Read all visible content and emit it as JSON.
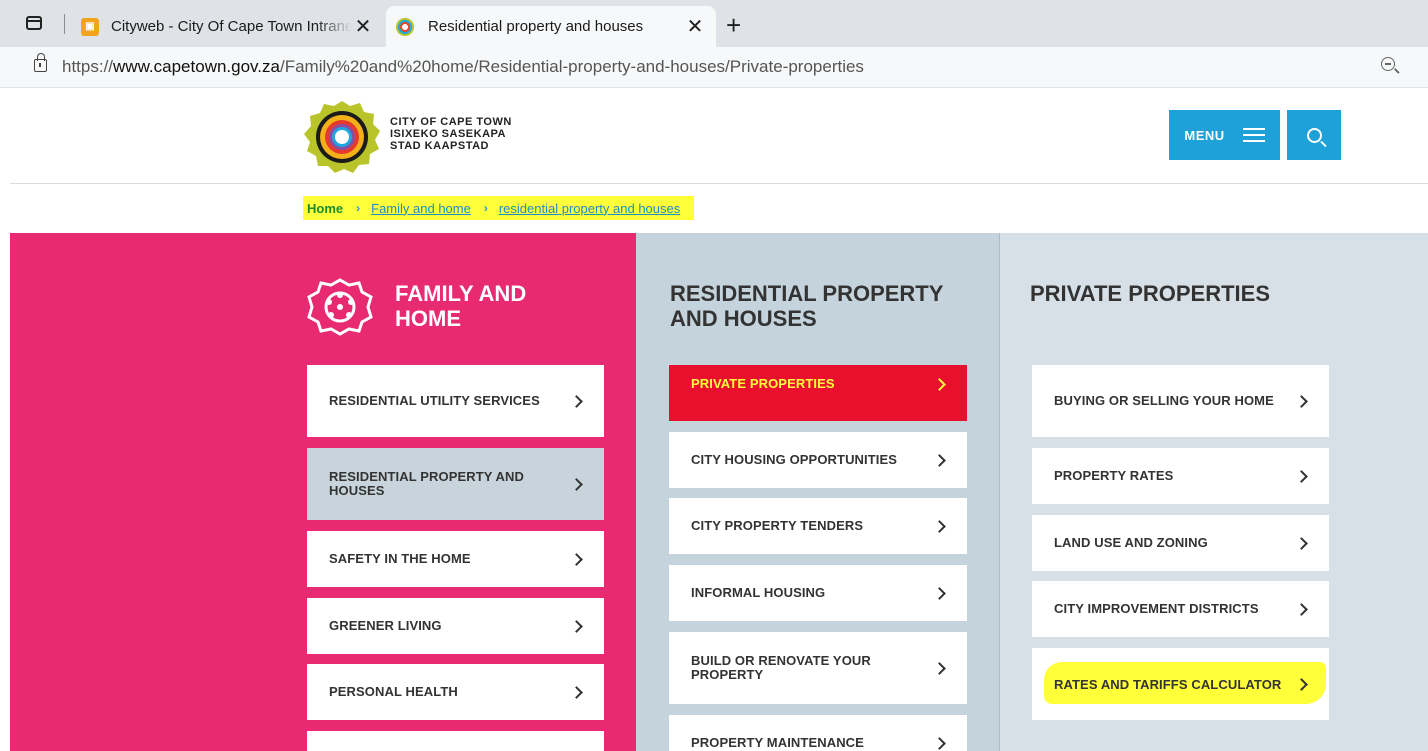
{
  "browser": {
    "tabs": [
      {
        "title": "Cityweb - City Of Cape Town Intranet",
        "favicon": "cityweb-favicon",
        "active": false
      },
      {
        "title": "Residential property and houses",
        "favicon": "cape-town-favicon",
        "active": true
      }
    ],
    "close_glyph": "✕",
    "new_tab_glyph": "+",
    "url_scheme": "https://",
    "url_host": "www.capetown.gov.za",
    "url_path": "/Family%20and%20home/Residential-property-and-houses/Private-properties"
  },
  "header": {
    "logo_lines": [
      "CITY OF CAPE TOWN",
      "ISIXEKO SASEKAPA",
      "STAD KAAPSTAD"
    ],
    "menu_label": "MENU"
  },
  "breadcrumb": {
    "home": "Home",
    "items": [
      "Family and home",
      "residential property and houses"
    ],
    "separator": "›"
  },
  "columns": {
    "family": {
      "title": "FAMILY AND HOME",
      "items": [
        "RESIDENTIAL UTILITY SERVICES",
        "RESIDENTIAL PROPERTY AND HOUSES",
        "SAFETY IN THE HOME",
        "GREENER LIVING",
        "PERSONAL HEALTH"
      ],
      "selected_index": 1
    },
    "residential": {
      "title": "RESIDENTIAL PROPERTY AND HOUSES",
      "items": [
        "PRIVATE PROPERTIES",
        "CITY HOUSING OPPORTUNITIES",
        "CITY PROPERTY TENDERS",
        "INFORMAL HOUSING",
        "BUILD OR RENOVATE YOUR PROPERTY",
        "PROPERTY MAINTENANCE"
      ],
      "selected_index": 0
    },
    "private": {
      "title": "PRIVATE PROPERTIES",
      "items": [
        "BUYING OR SELLING YOUR HOME",
        "PROPERTY RATES",
        "LAND USE AND ZONING",
        "CITY IMPROVEMENT DISTRICTS",
        "RATES AND TARIFFS CALCULATOR"
      ],
      "highlighted_index": 4
    }
  },
  "colors": {
    "pink": "#e82a73",
    "blue_panel": "#c5d3dc",
    "light_panel": "#d6e0e6",
    "accent_blue": "#1da1d8",
    "highlight_yellow": "#ffff3a",
    "highlight_red": "#e8102c"
  }
}
